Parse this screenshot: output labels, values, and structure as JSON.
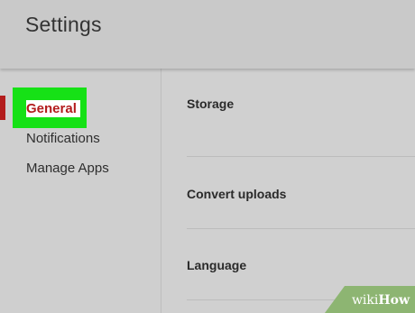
{
  "header": {
    "title": "Settings"
  },
  "sidebar": {
    "items": [
      {
        "label": "General",
        "active": true
      },
      {
        "label": "Notifications",
        "active": false
      },
      {
        "label": "Manage Apps",
        "active": false
      }
    ]
  },
  "main": {
    "sections": [
      {
        "title": "Storage"
      },
      {
        "title": "Convert uploads"
      },
      {
        "title": "Language"
      }
    ]
  },
  "watermark": {
    "prefix": "wiki",
    "suffix": "How"
  },
  "colors": {
    "accent": "#b31c1c",
    "highlight": "#16e116",
    "header_bg": "#c9c9c9",
    "page_bg": "#cfcfcf",
    "watermark_bg": "#8db572"
  }
}
